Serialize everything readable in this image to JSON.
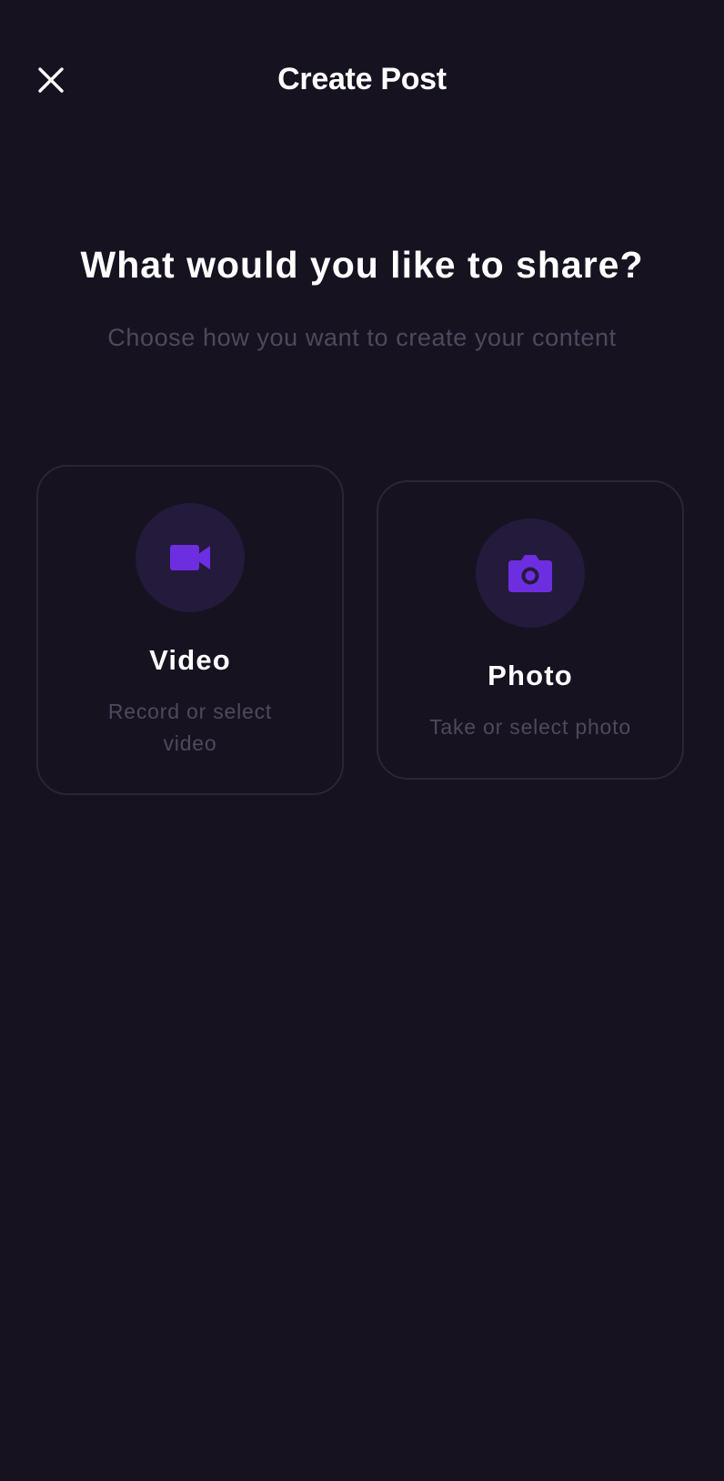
{
  "header": {
    "title": "Create Post",
    "close_icon": "close-icon"
  },
  "main": {
    "heading": "What would you like to share?",
    "subheading": "Choose how you want to create your content"
  },
  "options": [
    {
      "label": "Video",
      "description": "Record or select video",
      "icon": "video-camera-icon"
    },
    {
      "label": "Photo",
      "description": "Take or select photo",
      "icon": "camera-icon"
    }
  ],
  "colors": {
    "background": "#161220",
    "accent": "#6d2ee0",
    "icon_bg": "#241a3b",
    "muted_text": "#4e4a5c",
    "card_border": "#2a2635"
  }
}
